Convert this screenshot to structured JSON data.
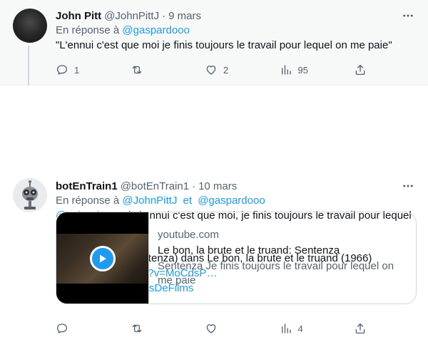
{
  "tweets": [
    {
      "author_name": "John Pitt",
      "author_handle": "@JohnPittJ",
      "separator": "·",
      "date": "9 mars",
      "reply_prefix": "En réponse à",
      "reply_mention": "@gaspardooo",
      "text": "\"L'ennui c'est que moi je finis toujours le travail pour lequel on me paie\"",
      "stats": {
        "replies": "1",
        "retweets": "",
        "likes": "2",
        "views": "95"
      }
    },
    {
      "author_name": "botEnTrain1",
      "author_handle": "@botEnTrain1",
      "separator": "·",
      "date": "10 mars",
      "reply_prefix": "En réponse à",
      "reply_mention_1": "@JohnPittJ",
      "reply_connector": "et",
      "reply_mention_2": "@gaspardooo",
      "text_mention": "@JohnPittJ",
      "text_line1": "Mais l'ennui c'est que moi, je finis toujours le travail pour lequel on me paie.",
      "text_line2": "Lee Van Cleef (Sentenza) dans Le bon, la brute et le truand (1966)",
      "link": "youtube.com/watch?v=MoCdsP…",
      "hashtags": "#BetFilm #RepliquesDeFilms",
      "card": {
        "domain": "youtube.com",
        "title": "Le bon, la brute et le truand: Sentenza",
        "description": "Sentenza Je finis toujours le travail pour lequel on me paie"
      },
      "stats": {
        "replies": "",
        "retweets": "",
        "likes": "",
        "views": "4"
      }
    }
  ],
  "icons": {
    "more": "more-horizontal-icon",
    "reply": "reply-icon",
    "retweet": "retweet-icon",
    "like": "heart-icon",
    "views": "analytics-icon",
    "share": "share-icon",
    "play": "play-icon"
  },
  "colors": {
    "accent": "#1d9bf0",
    "secondary_text": "#536471",
    "primary_text": "#0f1419",
    "highlight_bg": "#f7f9f9"
  }
}
